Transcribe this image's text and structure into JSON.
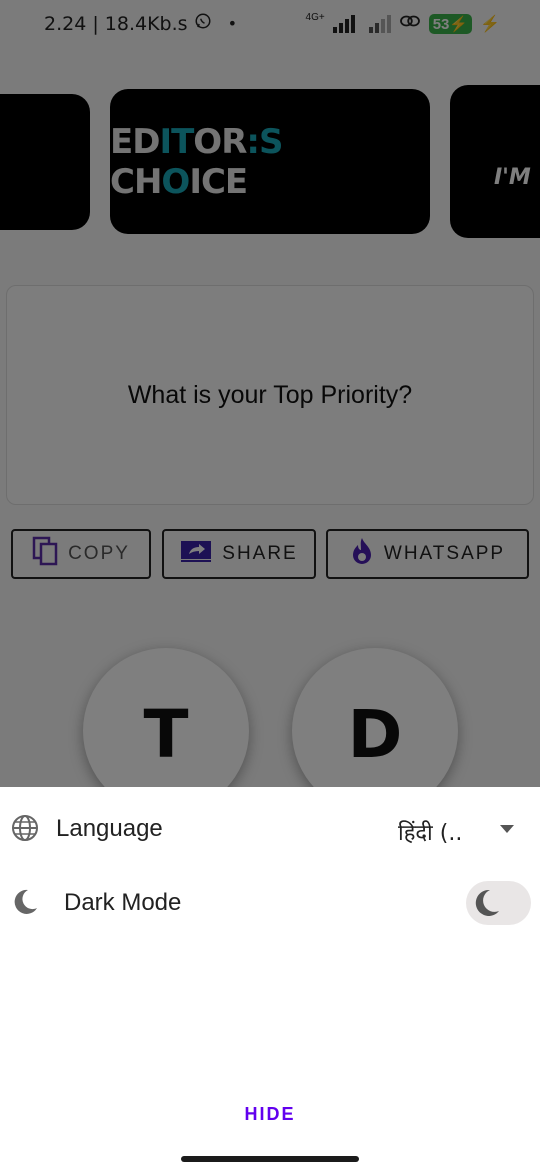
{
  "status_bar": {
    "time_speed": "2.24 | 18.4Kb.s",
    "network": "4G+",
    "battery": "53"
  },
  "carousel": {
    "center_title_part1": "ED",
    "center_title_part2": "IT",
    "center_title_part3": "OR",
    "center_title_part4": ":S",
    "center_title_part5": " CH",
    "center_title_part6": "O",
    "center_title_part7": "ICE",
    "right_partial_text": "I'M"
  },
  "quote": {
    "text": "What is your Top Priority?"
  },
  "actions": {
    "copy_label": "COPY",
    "share_label": "SHARE",
    "whatsapp_label": "WHATSAPP"
  },
  "avatars": {
    "first": "T",
    "second": "D"
  },
  "sheet": {
    "language_label": "Language",
    "language_value": "हिंदी (..",
    "dark_mode_label": "Dark Mode",
    "dark_mode_on": false,
    "hide_label": "HIDE"
  },
  "colors": {
    "accent": "#6200ee",
    "teal": "#19a9b8",
    "battery": "#3ab34a"
  }
}
